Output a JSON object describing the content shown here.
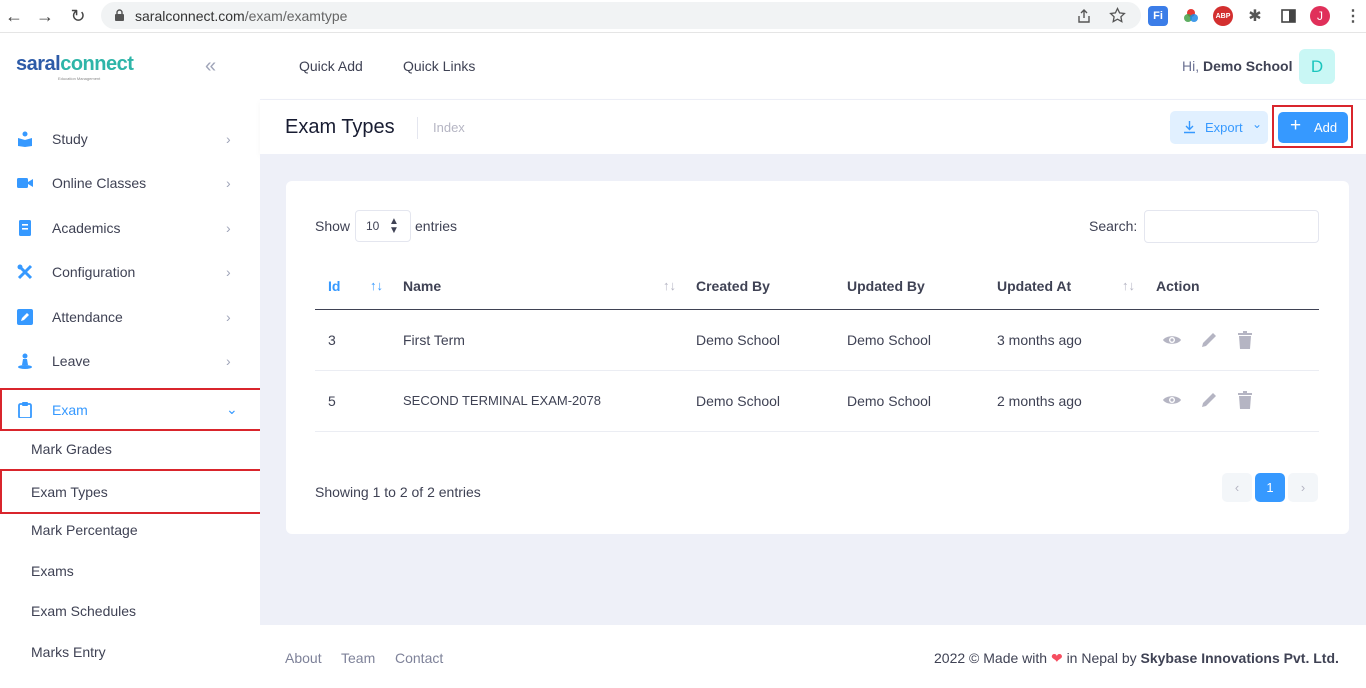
{
  "browser": {
    "url_host": "saralconnect.com",
    "url_path": "/exam/examtype",
    "profile_initial": "J"
  },
  "sidebar": {
    "logo_main": "saral",
    "logo_accent": "connect",
    "logo_sub": "Education Management",
    "items": [
      {
        "label": "Study",
        "icon": "book-reader-icon"
      },
      {
        "label": "Online Classes",
        "icon": "video-camera-icon"
      },
      {
        "label": "Academics",
        "icon": "notebook-icon"
      },
      {
        "label": "Configuration",
        "icon": "tools-icon"
      },
      {
        "label": "Attendance",
        "icon": "edit-box-icon"
      },
      {
        "label": "Leave",
        "icon": "person-icon"
      },
      {
        "label": "Exam",
        "icon": "clipboard-icon"
      }
    ],
    "exam_sub": [
      {
        "label": "Mark Grades"
      },
      {
        "label": "Exam Types"
      },
      {
        "label": "Mark Percentage"
      },
      {
        "label": "Exams"
      },
      {
        "label": "Exam Schedules"
      },
      {
        "label": "Marks Entry"
      }
    ]
  },
  "header": {
    "quick_add": "Quick Add",
    "quick_links": "Quick Links",
    "greeting": "Hi,",
    "user_name": "Demo School",
    "avatar_initial": "D"
  },
  "subheader": {
    "title": "Exam Types",
    "breadcrumb": "Index",
    "export_label": "Export",
    "add_label": "Add"
  },
  "table": {
    "show_label": "Show",
    "page_size": "10",
    "entries_label": "entries",
    "search_label": "Search:",
    "columns": [
      "Id",
      "Name",
      "Created By",
      "Updated By",
      "Updated At",
      "Action"
    ],
    "rows": [
      {
        "id": "3",
        "name": "First Term",
        "created_by": "Demo School",
        "updated_by": "Demo School",
        "updated_at": "3 months ago"
      },
      {
        "id": "5",
        "name": "SECOND TERMINAL EXAM-2078",
        "created_by": "Demo School",
        "updated_by": "Demo School",
        "updated_at": "2 months ago"
      }
    ],
    "showing": "Showing 1 to 2 of 2 entries",
    "current_page": "1"
  },
  "footer": {
    "links": [
      "About",
      "Team",
      "Contact"
    ],
    "copyright_prefix": "2022 ©  Made with",
    "copyright_mid": "in Nepal by",
    "company": "Skybase Innovations Pvt. Ltd."
  },
  "colors": {
    "primary": "#3699ff",
    "highlight": "#d9252c",
    "background": "#eef0f8"
  }
}
